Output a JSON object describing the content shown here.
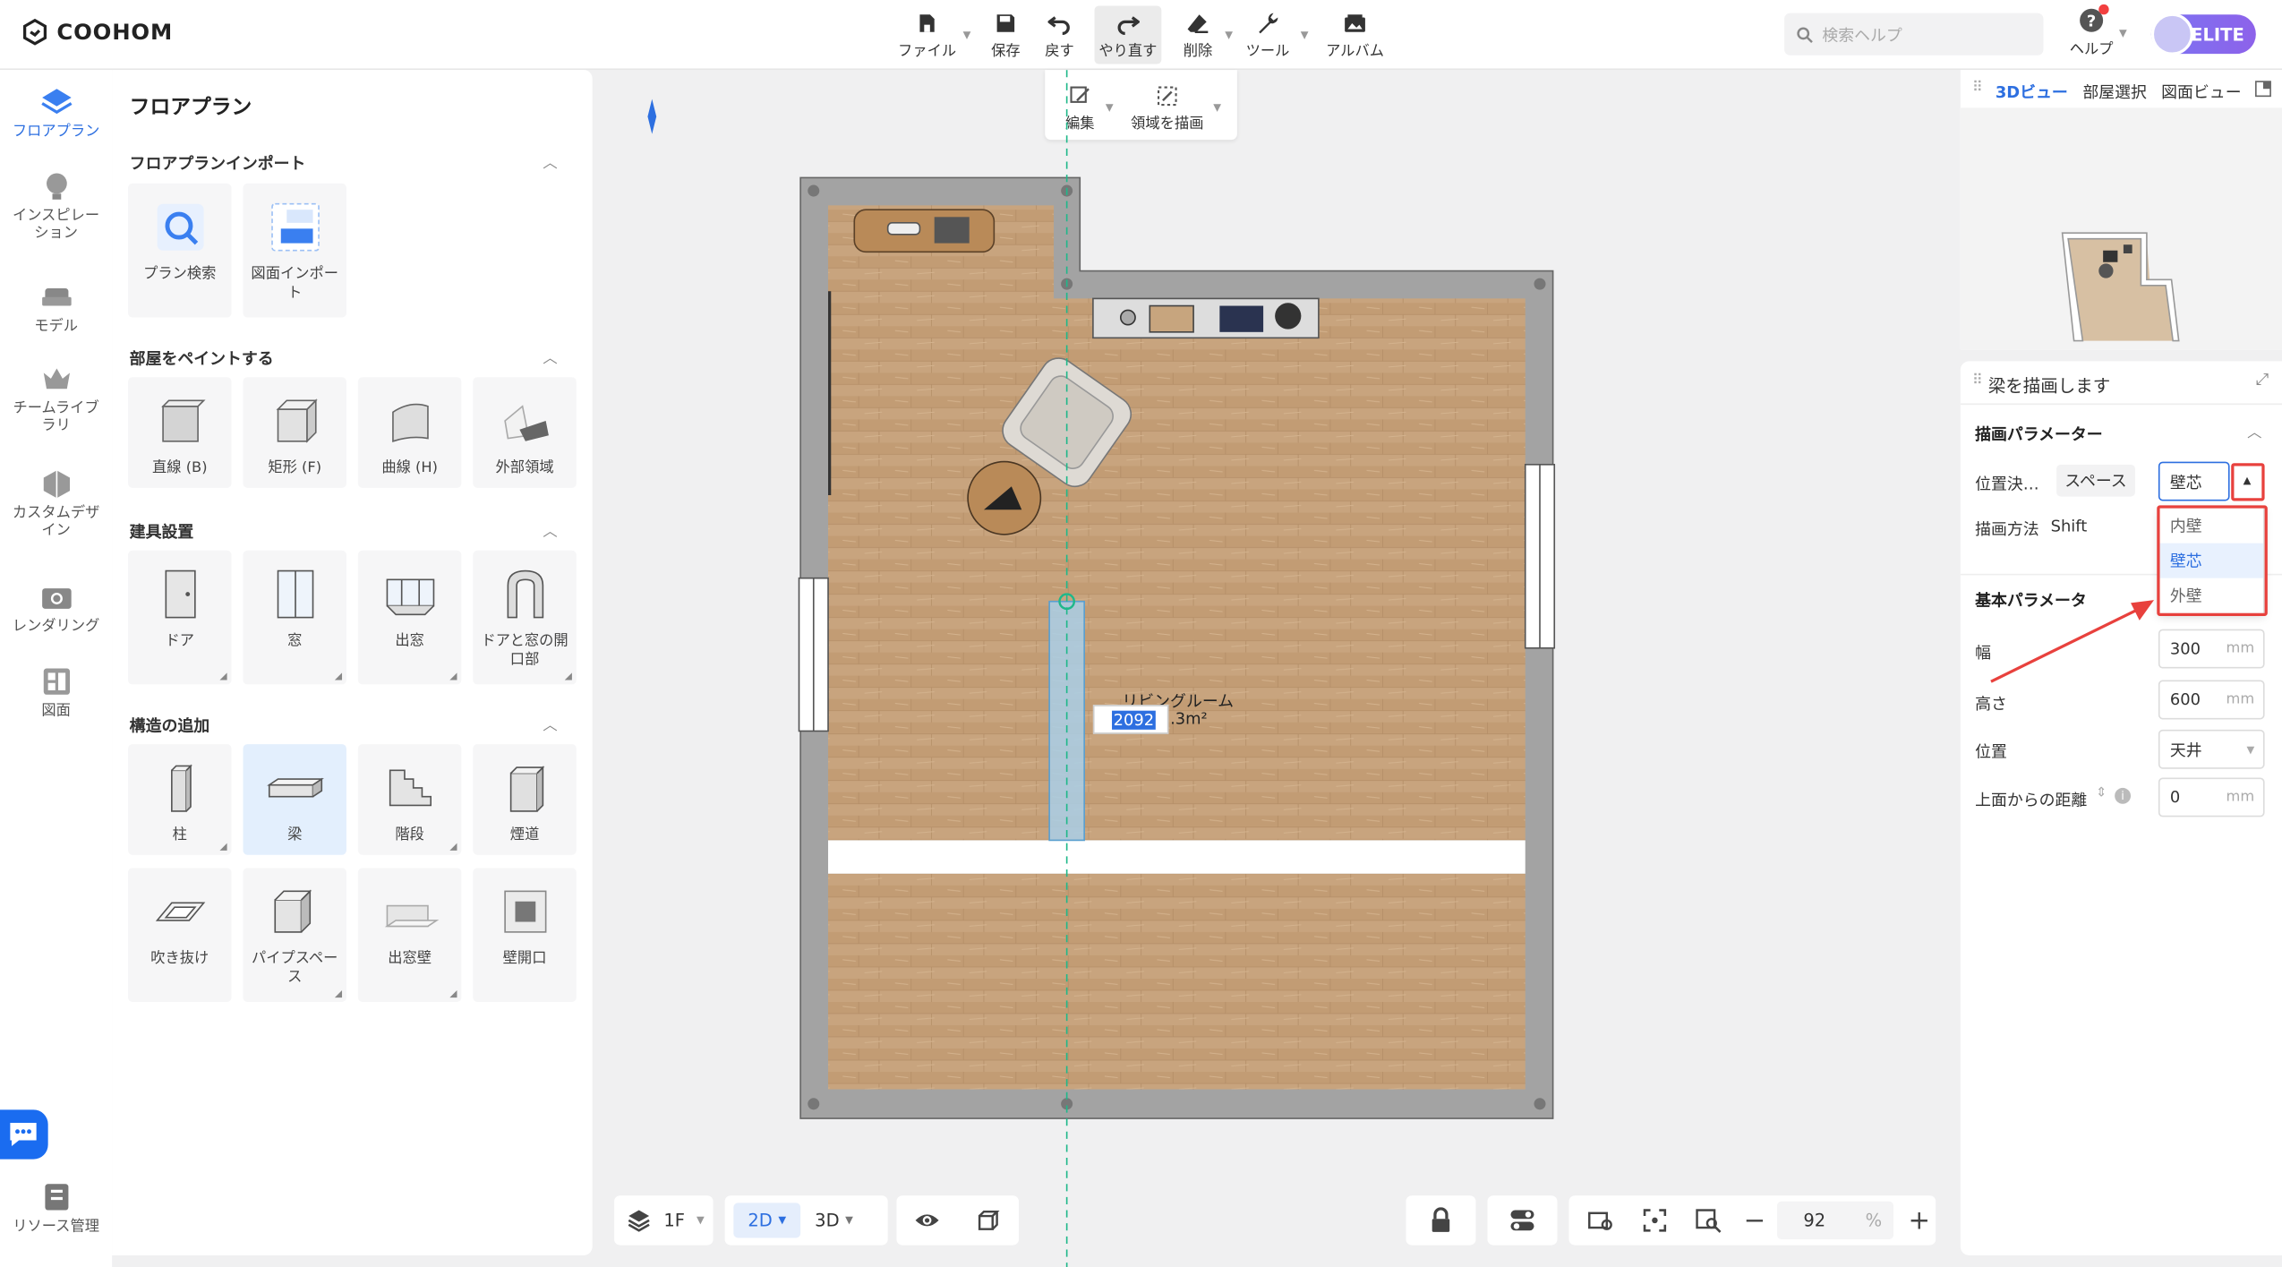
{
  "app": {
    "logo": "COOHOM"
  },
  "toolbar": {
    "file": "ファイル",
    "save": "保存",
    "undo": "戻す",
    "redo": "やり直す",
    "delete": "削除",
    "tools": "ツール",
    "album": "アルバム",
    "sub_edit": "編集",
    "sub_draw_area": "領域を描画"
  },
  "search": {
    "placeholder": "検索ヘルプ"
  },
  "header": {
    "help": "ヘルプ",
    "badge": "ELITE"
  },
  "left_nav": {
    "items": [
      "フロアプラン",
      "インスピレーション",
      "モデル",
      "チームライブラリ",
      "カスタムデザイン",
      "レンダリング",
      "図面"
    ],
    "resource": "リソース管理"
  },
  "panel": {
    "title": "フロアプラン",
    "sections": [
      {
        "title": "フロアプランインポート",
        "items": [
          "プラン検索",
          "図面インポート"
        ]
      },
      {
        "title": "部屋をペイントする",
        "items": [
          "直線 (B)",
          "矩形 (F)",
          "曲線 (H)",
          "外部領域"
        ]
      },
      {
        "title": "建具設置",
        "items": [
          "ドア",
          "窓",
          "出窓",
          "ドアと窓の開口部"
        ]
      },
      {
        "title": "構造の追加",
        "items": [
          "柱",
          "梁",
          "階段",
          "煙道",
          "吹き抜け",
          "パイプスペース",
          "出窓壁",
          "壁開口"
        ]
      }
    ]
  },
  "canvas": {
    "room_name": "リビングルーム",
    "dimension_input": "2092",
    "area": ".3m²"
  },
  "bottom_bar": {
    "floor": "1F",
    "view2d": "2D",
    "view3d": "3D",
    "zoom": "92",
    "zoom_unit": "%"
  },
  "right_view": {
    "tabs": [
      "3Dビュー",
      "部屋選択",
      "図面ビュー"
    ]
  },
  "right_panel": {
    "title": "梁を描画します",
    "draw_params": "描画パラメーター",
    "position_label": "位置決…",
    "space_btn": "スペース",
    "position_value": "壁芯",
    "draw_method_label": "描画方法",
    "draw_method_value": "Shift",
    "dropdown_options": [
      "内壁",
      "壁芯",
      "外壁"
    ],
    "dropdown_selected": "壁芯",
    "basic_params": "基本パラメータ",
    "width_label": "幅",
    "width_value": "300",
    "height_label": "高さ",
    "height_value": "600",
    "location_label": "位置",
    "location_value": "天井",
    "offset_label": "上面からの距離",
    "offset_value": "0",
    "unit": "mm"
  },
  "colors": {
    "accent": "#2d6fe0",
    "highlight": "#e8413d",
    "elite": "#7b74f2",
    "wall": "#9d9d9d",
    "floor": "#c9a57e"
  }
}
